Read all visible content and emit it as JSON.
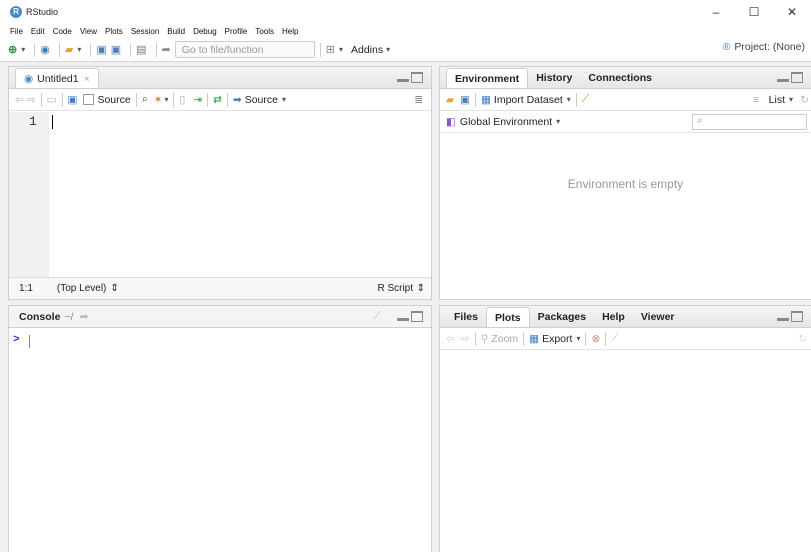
{
  "window": {
    "title": "RStudio",
    "controls": {
      "minimize": "–",
      "maximize": "☐",
      "close": "✕"
    }
  },
  "menu": [
    "File",
    "Edit",
    "Code",
    "View",
    "Plots",
    "Session",
    "Build",
    "Debug",
    "Profile",
    "Tools",
    "Help"
  ],
  "toolbar": {
    "goto_placeholder": "Go to file/function",
    "addins_label": "Addins",
    "project_label": "Project: (None)"
  },
  "source_pane": {
    "tab_label": "Untitled1",
    "tab_close": "×",
    "source_on_save_label": "Source",
    "source_label": "Source",
    "line_number": "1",
    "cursor_pos": "1:1",
    "scope": "(Top Level)",
    "file_type": "R Script"
  },
  "console_pane": {
    "tab_label": "Console",
    "path": "~/",
    "prompt": ">"
  },
  "env_pane": {
    "tabs": [
      "Environment",
      "History",
      "Connections"
    ],
    "import_dataset_label": "Import Dataset",
    "list_label": "List",
    "global_env_label": "Global Environment",
    "empty_message": "Environment is empty"
  },
  "files_pane": {
    "tabs": [
      "Files",
      "Plots",
      "Packages",
      "Help",
      "Viewer"
    ],
    "zoom_label": "Zoom",
    "export_label": "Export"
  },
  "colors": {
    "accent": "#4a88c7",
    "prompt": "#1a3bd1"
  }
}
